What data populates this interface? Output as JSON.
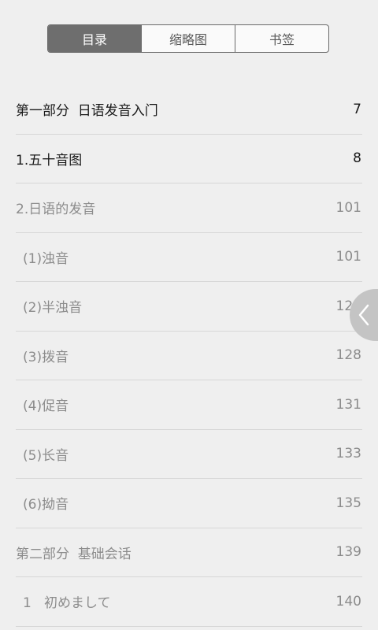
{
  "tabs": [
    {
      "label": "目录",
      "active": true
    },
    {
      "label": "缩略图",
      "active": false
    },
    {
      "label": "书签",
      "active": false
    }
  ],
  "toc": [
    {
      "title": "第一部分  日语发音入门",
      "page": "7",
      "style": "dark",
      "indent": false
    },
    {
      "title": "1.五十音图",
      "page": "8",
      "style": "dark",
      "indent": false
    },
    {
      "title": "2.日语的发音",
      "page": "101",
      "style": "light",
      "indent": false
    },
    {
      "title": "(1)浊音",
      "page": "101",
      "style": "light",
      "indent": true
    },
    {
      "title": "(2)半浊音",
      "page": "122",
      "style": "light",
      "indent": true
    },
    {
      "title": "(3)拨音",
      "page": "128",
      "style": "light",
      "indent": true
    },
    {
      "title": "(4)促音",
      "page": "131",
      "style": "light",
      "indent": true
    },
    {
      "title": "(5)长音",
      "page": "133",
      "style": "light",
      "indent": true
    },
    {
      "title": "(6)拗音",
      "page": "135",
      "style": "light",
      "indent": true
    },
    {
      "title": "第二部分  基础会话",
      "page": "139",
      "style": "light",
      "indent": false
    },
    {
      "title": "1   初めまして",
      "page": "140",
      "style": "light",
      "indent": true
    }
  ],
  "side_handle": {
    "icon": "chevron-left-icon"
  }
}
